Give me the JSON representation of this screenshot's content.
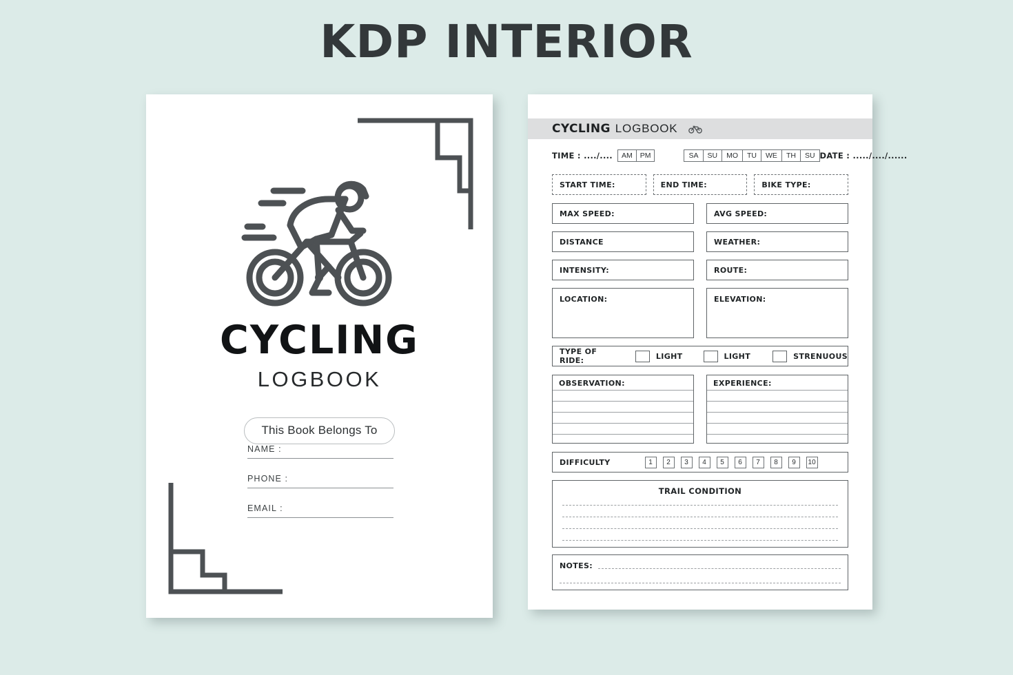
{
  "banner": {
    "title": "KDP INTERIOR"
  },
  "colors": {
    "background": "#dcebe8",
    "page": "#ffffff",
    "ink": "#1f2325",
    "header_bar": "#dddedf",
    "rule": "#5f6467"
  },
  "cover": {
    "illustration_icon": "cyclist-icon",
    "ornament_top_right": "stepped-corner-ornament",
    "ornament_bottom_left": "stepped-corner-ornament",
    "title": "CYCLING",
    "subtitle": "LOGBOOK",
    "belongs_to": "This Book Belongs To",
    "fields": [
      {
        "label": "NAME :"
      },
      {
        "label": "PHONE :"
      },
      {
        "label": "EMAIL :"
      }
    ]
  },
  "interior": {
    "header": {
      "title_bold": "CYCLING",
      "title_light": "LOGBOOK",
      "icon": "bicycle-icon"
    },
    "timeline": {
      "time_label": "TIME : ..../....",
      "ampm": [
        "AM",
        "PM"
      ],
      "days": [
        "SA",
        "SU",
        "MO",
        "TU",
        "WE",
        "TH",
        "SU"
      ],
      "date_label": "DATE : ...../..../......"
    },
    "dashed_fields": [
      {
        "label": "START TIME:"
      },
      {
        "label": "END TIME:"
      },
      {
        "label": "BIKE TYPE:"
      }
    ],
    "field_rows": [
      {
        "left": "MAX SPEED:",
        "right": "AVG SPEED:"
      },
      {
        "left": "DISTANCE",
        "right": "WEATHER:"
      },
      {
        "left": "INTENSITY:",
        "right": "ROUTE:"
      }
    ],
    "tall_fields": {
      "left": "LOCATION:",
      "right": "ELEVATION:"
    },
    "type_of_ride": {
      "label": "TYPE OF RIDE:",
      "options": [
        "LIGHT",
        "LIGHT",
        "STRENUOUS"
      ]
    },
    "ruled_fields": {
      "left": "OBSERVATION:",
      "right": "EXPERIENCE:"
    },
    "difficulty": {
      "label": "DIFFICULTY",
      "scale": [
        "1",
        "2",
        "3",
        "4",
        "5",
        "6",
        "7",
        "8",
        "9",
        "10"
      ]
    },
    "trail_condition": {
      "title": "TRAIL CONDITION",
      "line_count": 4
    },
    "notes": {
      "label": "NOTES:"
    }
  }
}
